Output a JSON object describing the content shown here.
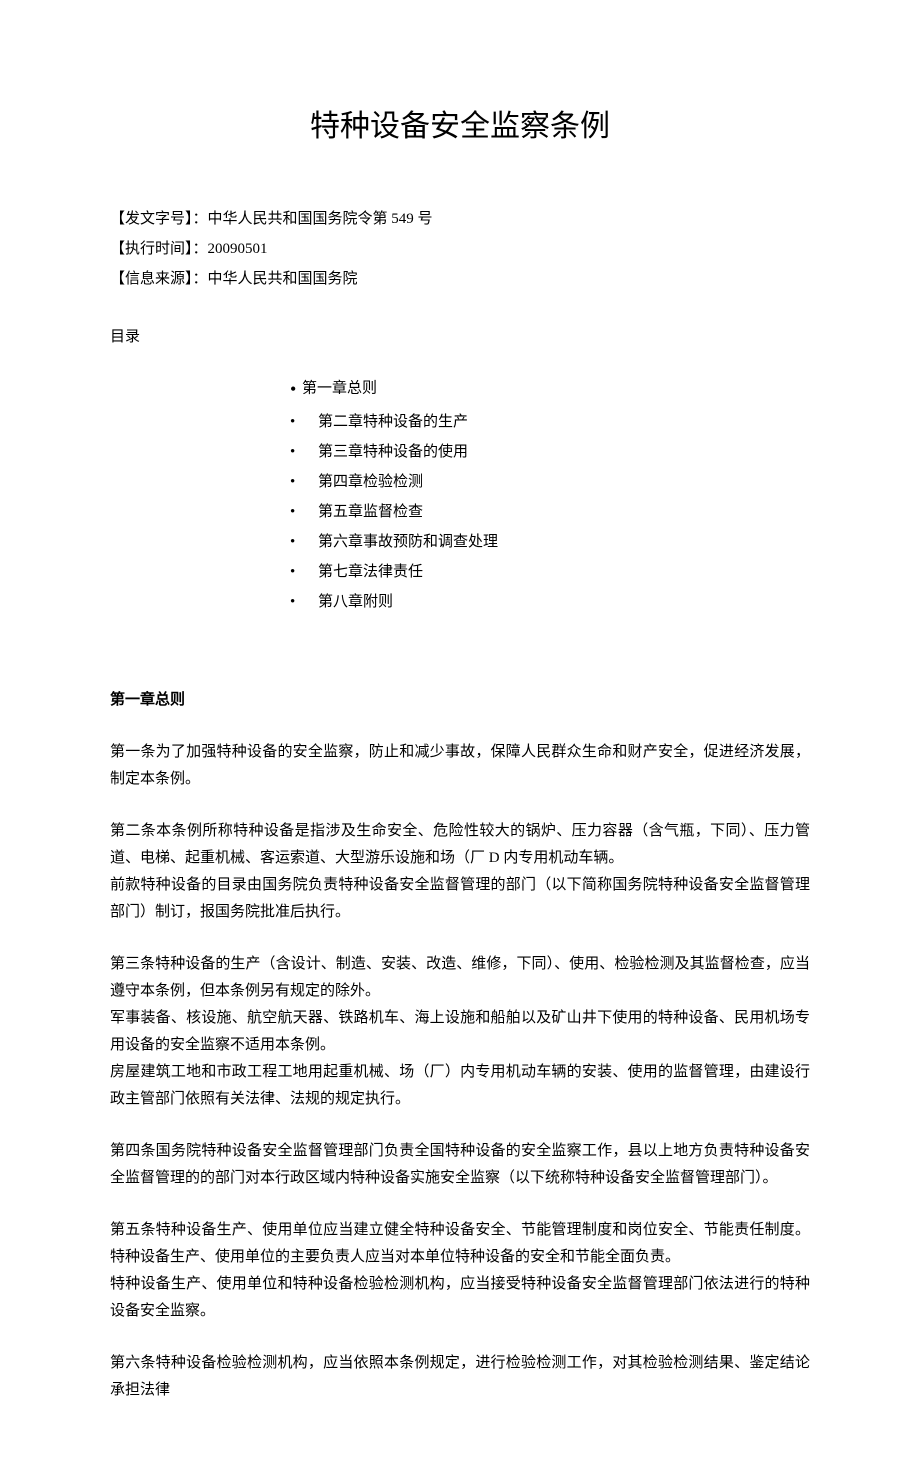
{
  "title": "特种设备安全监察条例",
  "meta": {
    "docno_label": "【发文字号】：",
    "docno": "中华人民共和国国务院令第 549 号",
    "exectime_label": "【执行时间】：",
    "exectime": "20090501",
    "source_label": "【信息来源】：",
    "source": "中华人民共和国国务院"
  },
  "toc_label": "目录",
  "toc": [
    "第一章总则",
    "第二章特种设备的生产",
    "第三章特种设备的使用",
    "第四章检验检测",
    "第五章监督检查",
    "第六章事故预防和调查处理",
    "第七章法律责任",
    "第八章附则"
  ],
  "chapter1_heading": "第一章总则",
  "articles": {
    "a1": "第一条为了加强特种设备的安全监察，防止和减少事故，保障人民群众生命和财产安全，促进经济发展，制定本条例。",
    "a2_p1": "第二条本条例所称特种设备是指涉及生命安全、危险性较大的锅炉、压力容器（含气瓶，下同）、压力管道、电梯、起重机械、客运索道、大型游乐设施和场（厂 D 内专用机动车辆。",
    "a2_p2": "前款特种设备的目录由国务院负责特种设备安全监督管理的部门（以下简称国务院特种设备安全监督管理部门）制订，报国务院批准后执行。",
    "a3_p1": "第三条特种设备的生产（含设计、制造、安装、改造、维修，下同）、使用、检验检测及其监督检查，应当遵守本条例，但本条例另有规定的除外。",
    "a3_p2": "军事装备、核设施、航空航天器、铁路机车、海上设施和船舶以及矿山井下使用的特种设备、民用机场专用设备的安全监察不适用本条例。",
    "a3_p3": "房屋建筑工地和市政工程工地用起重机械、场（厂）内专用机动车辆的安装、使用的监督管理，由建设行政主管部门依照有关法律、法规的规定执行。",
    "a4": "第四条国务院特种设备安全监督管理部门负责全国特种设备的安全监察工作，县以上地方负责特种设备安全监督管理的的部门对本行政区域内特种设备实施安全监察（以下统称特种设备安全监督管理部门）。",
    "a5_p1": "第五条特种设备生产、使用单位应当建立健全特种设备安全、节能管理制度和岗位安全、节能责任制度。特种设备生产、使用单位的主要负责人应当对本单位特种设备的安全和节能全面负责。",
    "a5_p2": "特种设备生产、使用单位和特种设备检验检测机构，应当接受特种设备安全监督管理部门依法进行的特种设备安全监察。",
    "a6": "第六条特种设备检验检测机构，应当依照本条例规定，进行检验检测工作，对其检验检测结果、鉴定结论承担法律"
  }
}
